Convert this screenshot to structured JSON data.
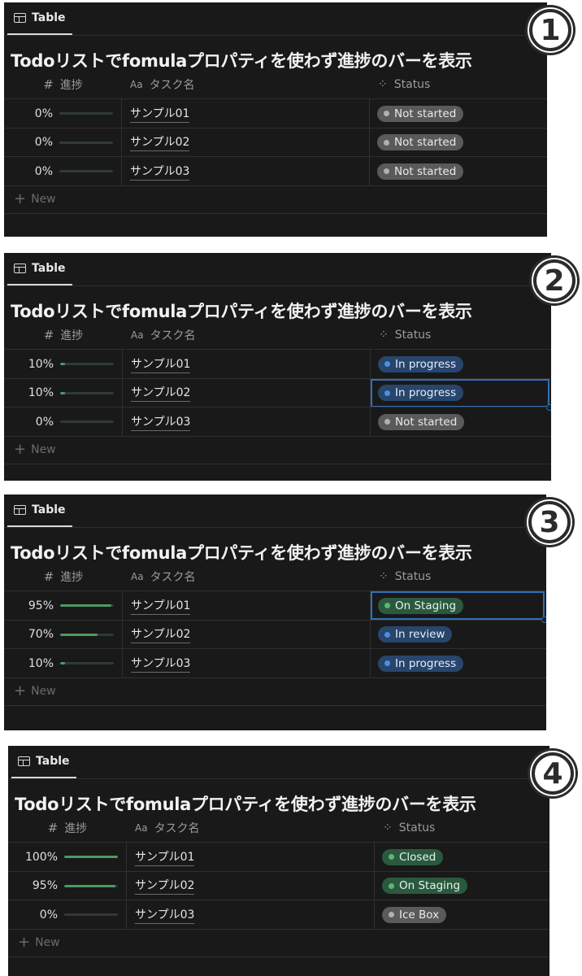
{
  "panels": [
    {
      "tab_label": "Table",
      "title": "Todoリストでfomulaプロパティを使わず進捗のバーを表示",
      "badge": "1",
      "headers": {
        "progress": "進捗",
        "name": "タスク名",
        "status": "Status",
        "name_icon": "Aa"
      },
      "rows": [
        {
          "progress_text": "0%",
          "progress": 0,
          "name": "サンプル01",
          "status": "Not started",
          "status_color": "gray",
          "selected": false
        },
        {
          "progress_text": "0%",
          "progress": 0,
          "name": "サンプル02",
          "status": "Not started",
          "status_color": "gray",
          "selected": false
        },
        {
          "progress_text": "0%",
          "progress": 0,
          "name": "サンプル03",
          "status": "Not started",
          "status_color": "gray",
          "selected": false
        }
      ],
      "new_label": "New"
    },
    {
      "tab_label": "Table",
      "title": "Todoリストでfomulaプロパティを使わず進捗のバーを表示",
      "badge": "2",
      "headers": {
        "progress": "進捗",
        "name": "タスク名",
        "status": "Status",
        "name_icon": "Aa"
      },
      "rows": [
        {
          "progress_text": "10%",
          "progress": 10,
          "name": "サンプル01",
          "status": "In progress",
          "status_color": "blue",
          "selected": false
        },
        {
          "progress_text": "10%",
          "progress": 10,
          "name": "サンプル02",
          "status": "In progress",
          "status_color": "blue",
          "selected": true
        },
        {
          "progress_text": "0%",
          "progress": 0,
          "name": "サンプル03",
          "status": "Not started",
          "status_color": "gray",
          "selected": false
        }
      ],
      "new_label": "New"
    },
    {
      "tab_label": "Table",
      "title": "Todoリストでfomulaプロパティを使わず進捗のバーを表示",
      "badge": "3",
      "headers": {
        "progress": "進捗",
        "name": "タスク名",
        "status": "Status",
        "name_icon": "Aa"
      },
      "rows": [
        {
          "progress_text": "95%",
          "progress": 95,
          "name": "サンプル01",
          "status": "On Staging",
          "status_color": "green",
          "selected": true
        },
        {
          "progress_text": "70%",
          "progress": 70,
          "name": "サンプル02",
          "status": "In review",
          "status_color": "blue",
          "selected": false
        },
        {
          "progress_text": "10%",
          "progress": 10,
          "name": "サンプル03",
          "status": "In progress",
          "status_color": "blue",
          "selected": false
        }
      ],
      "new_label": "New"
    },
    {
      "tab_label": "Table",
      "title": "Todoリストでfomulaプロパティを使わず進捗のバーを表示",
      "badge": "4",
      "headers": {
        "progress": "進捗",
        "name": "タスク名",
        "status": "Status",
        "name_icon": "Aa"
      },
      "rows": [
        {
          "progress_text": "100%",
          "progress": 100,
          "name": "サンプル01",
          "status": "Closed",
          "status_color": "green",
          "selected": false
        },
        {
          "progress_text": "95%",
          "progress": 95,
          "name": "サンプル02",
          "status": "On Staging",
          "status_color": "green",
          "selected": false
        },
        {
          "progress_text": "0%",
          "progress": 0,
          "name": "サンプル03",
          "status": "Ice Box",
          "status_color": "gray",
          "selected": false
        }
      ],
      "new_label": "New"
    }
  ]
}
